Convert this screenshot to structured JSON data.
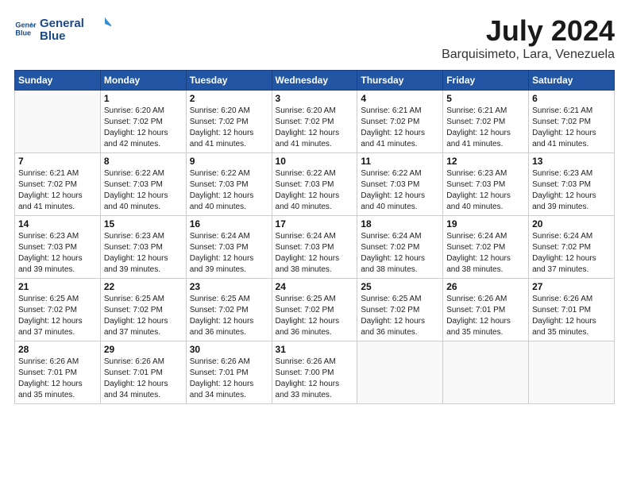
{
  "header": {
    "logo_line1": "General",
    "logo_line2": "Blue",
    "title": "July 2024",
    "subtitle": "Barquisimeto, Lara, Venezuela"
  },
  "weekdays": [
    "Sunday",
    "Monday",
    "Tuesday",
    "Wednesday",
    "Thursday",
    "Friday",
    "Saturday"
  ],
  "weeks": [
    [
      {
        "day": "",
        "info": ""
      },
      {
        "day": "1",
        "info": "Sunrise: 6:20 AM\nSunset: 7:02 PM\nDaylight: 12 hours\nand 42 minutes."
      },
      {
        "day": "2",
        "info": "Sunrise: 6:20 AM\nSunset: 7:02 PM\nDaylight: 12 hours\nand 41 minutes."
      },
      {
        "day": "3",
        "info": "Sunrise: 6:20 AM\nSunset: 7:02 PM\nDaylight: 12 hours\nand 41 minutes."
      },
      {
        "day": "4",
        "info": "Sunrise: 6:21 AM\nSunset: 7:02 PM\nDaylight: 12 hours\nand 41 minutes."
      },
      {
        "day": "5",
        "info": "Sunrise: 6:21 AM\nSunset: 7:02 PM\nDaylight: 12 hours\nand 41 minutes."
      },
      {
        "day": "6",
        "info": "Sunrise: 6:21 AM\nSunset: 7:02 PM\nDaylight: 12 hours\nand 41 minutes."
      }
    ],
    [
      {
        "day": "7",
        "info": "Sunrise: 6:21 AM\nSunset: 7:02 PM\nDaylight: 12 hours\nand 41 minutes."
      },
      {
        "day": "8",
        "info": "Sunrise: 6:22 AM\nSunset: 7:03 PM\nDaylight: 12 hours\nand 40 minutes."
      },
      {
        "day": "9",
        "info": "Sunrise: 6:22 AM\nSunset: 7:03 PM\nDaylight: 12 hours\nand 40 minutes."
      },
      {
        "day": "10",
        "info": "Sunrise: 6:22 AM\nSunset: 7:03 PM\nDaylight: 12 hours\nand 40 minutes."
      },
      {
        "day": "11",
        "info": "Sunrise: 6:22 AM\nSunset: 7:03 PM\nDaylight: 12 hours\nand 40 minutes."
      },
      {
        "day": "12",
        "info": "Sunrise: 6:23 AM\nSunset: 7:03 PM\nDaylight: 12 hours\nand 40 minutes."
      },
      {
        "day": "13",
        "info": "Sunrise: 6:23 AM\nSunset: 7:03 PM\nDaylight: 12 hours\nand 39 minutes."
      }
    ],
    [
      {
        "day": "14",
        "info": "Sunrise: 6:23 AM\nSunset: 7:03 PM\nDaylight: 12 hours\nand 39 minutes."
      },
      {
        "day": "15",
        "info": "Sunrise: 6:23 AM\nSunset: 7:03 PM\nDaylight: 12 hours\nand 39 minutes."
      },
      {
        "day": "16",
        "info": "Sunrise: 6:24 AM\nSunset: 7:03 PM\nDaylight: 12 hours\nand 39 minutes."
      },
      {
        "day": "17",
        "info": "Sunrise: 6:24 AM\nSunset: 7:03 PM\nDaylight: 12 hours\nand 38 minutes."
      },
      {
        "day": "18",
        "info": "Sunrise: 6:24 AM\nSunset: 7:02 PM\nDaylight: 12 hours\nand 38 minutes."
      },
      {
        "day": "19",
        "info": "Sunrise: 6:24 AM\nSunset: 7:02 PM\nDaylight: 12 hours\nand 38 minutes."
      },
      {
        "day": "20",
        "info": "Sunrise: 6:24 AM\nSunset: 7:02 PM\nDaylight: 12 hours\nand 37 minutes."
      }
    ],
    [
      {
        "day": "21",
        "info": "Sunrise: 6:25 AM\nSunset: 7:02 PM\nDaylight: 12 hours\nand 37 minutes."
      },
      {
        "day": "22",
        "info": "Sunrise: 6:25 AM\nSunset: 7:02 PM\nDaylight: 12 hours\nand 37 minutes."
      },
      {
        "day": "23",
        "info": "Sunrise: 6:25 AM\nSunset: 7:02 PM\nDaylight: 12 hours\nand 36 minutes."
      },
      {
        "day": "24",
        "info": "Sunrise: 6:25 AM\nSunset: 7:02 PM\nDaylight: 12 hours\nand 36 minutes."
      },
      {
        "day": "25",
        "info": "Sunrise: 6:25 AM\nSunset: 7:02 PM\nDaylight: 12 hours\nand 36 minutes."
      },
      {
        "day": "26",
        "info": "Sunrise: 6:26 AM\nSunset: 7:01 PM\nDaylight: 12 hours\nand 35 minutes."
      },
      {
        "day": "27",
        "info": "Sunrise: 6:26 AM\nSunset: 7:01 PM\nDaylight: 12 hours\nand 35 minutes."
      }
    ],
    [
      {
        "day": "28",
        "info": "Sunrise: 6:26 AM\nSunset: 7:01 PM\nDaylight: 12 hours\nand 35 minutes."
      },
      {
        "day": "29",
        "info": "Sunrise: 6:26 AM\nSunset: 7:01 PM\nDaylight: 12 hours\nand 34 minutes."
      },
      {
        "day": "30",
        "info": "Sunrise: 6:26 AM\nSunset: 7:01 PM\nDaylight: 12 hours\nand 34 minutes."
      },
      {
        "day": "31",
        "info": "Sunrise: 6:26 AM\nSunset: 7:00 PM\nDaylight: 12 hours\nand 33 minutes."
      },
      {
        "day": "",
        "info": ""
      },
      {
        "day": "",
        "info": ""
      },
      {
        "day": "",
        "info": ""
      }
    ]
  ]
}
